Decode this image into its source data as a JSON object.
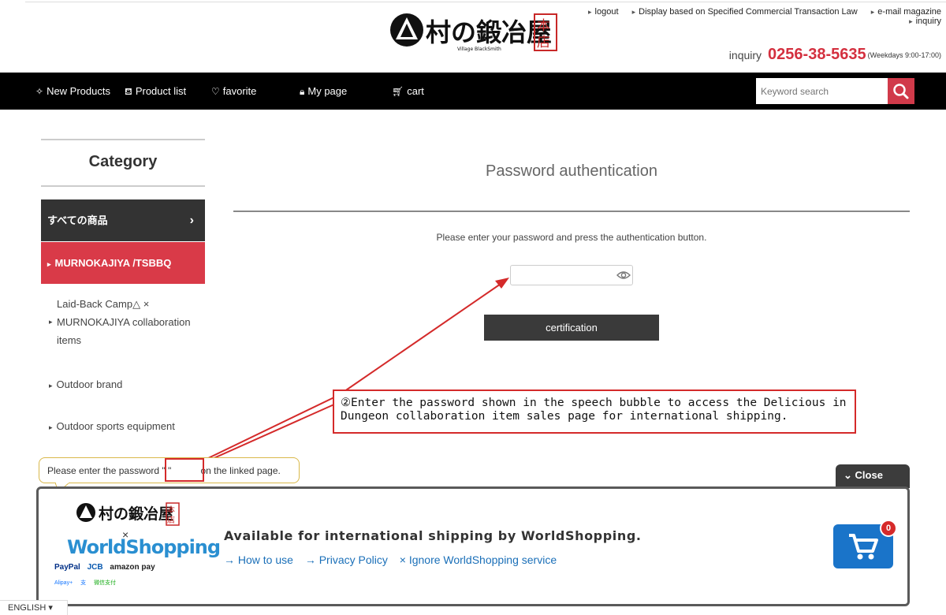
{
  "header": {
    "logo_text": "村の鍛冶屋 本店",
    "logo_sub": "Village BlackSmith",
    "links_row1": [
      "logout",
      "Display based on Specified Commercial Transaction Law",
      "e-mail magazine"
    ],
    "links_row2": [
      "inquiry"
    ],
    "inquiry_label": "inquiry",
    "phone": "0256-38-5635",
    "hours": "(Weekdays 9:00-17:00)"
  },
  "nav": {
    "items": [
      {
        "icon": "sparkle-icon",
        "label": "New Products"
      },
      {
        "icon": "bag-icon",
        "label": "Product list"
      },
      {
        "icon": "heart-icon",
        "label": "favorite"
      },
      {
        "icon": "lock-icon",
        "label": "My page"
      },
      {
        "icon": "cart-icon",
        "label": "cart"
      }
    ],
    "search_placeholder": "Keyword search"
  },
  "sidebar": {
    "title": "Category",
    "all": "すべての商品",
    "active": "MURNOKAJIYA /TSBBQ",
    "subs": [
      "Laid-Back Camp△ × MURNOKAJIYA collaboration items",
      "Outdoor brand",
      "Outdoor sports equipment"
    ]
  },
  "main": {
    "title": "Password authentication",
    "description": "Please enter your password and press the authentication button.",
    "password_value": "",
    "button": "certification"
  },
  "annotation": {
    "text": "②Enter the password shown in the speech bubble to access the Delicious in Dungeon collaboration item sales page for international shipping."
  },
  "bubble": {
    "before": "Please enter the password",
    "quote": "\"         \"",
    "after": "on the linked page."
  },
  "worldshopping": {
    "close_label": "Close",
    "times": "×",
    "brand": "WorldShopping",
    "payments": [
      "PayPal",
      "JCB",
      "amazon pay"
    ],
    "payments2": [
      "Alipay+",
      "支",
      "微信支付"
    ],
    "message": "Available for international shipping by WorldShopping.",
    "links": [
      "→ How to use",
      "→ Privacy Policy",
      "× Ignore WorldShopping service"
    ],
    "cart_count": "0"
  },
  "language": "ENGLISH ▾",
  "colors": {
    "accent": "#d93a48",
    "nav_bg": "#000000",
    "link": "#1a6fb8",
    "annotation": "#d42a2a"
  }
}
